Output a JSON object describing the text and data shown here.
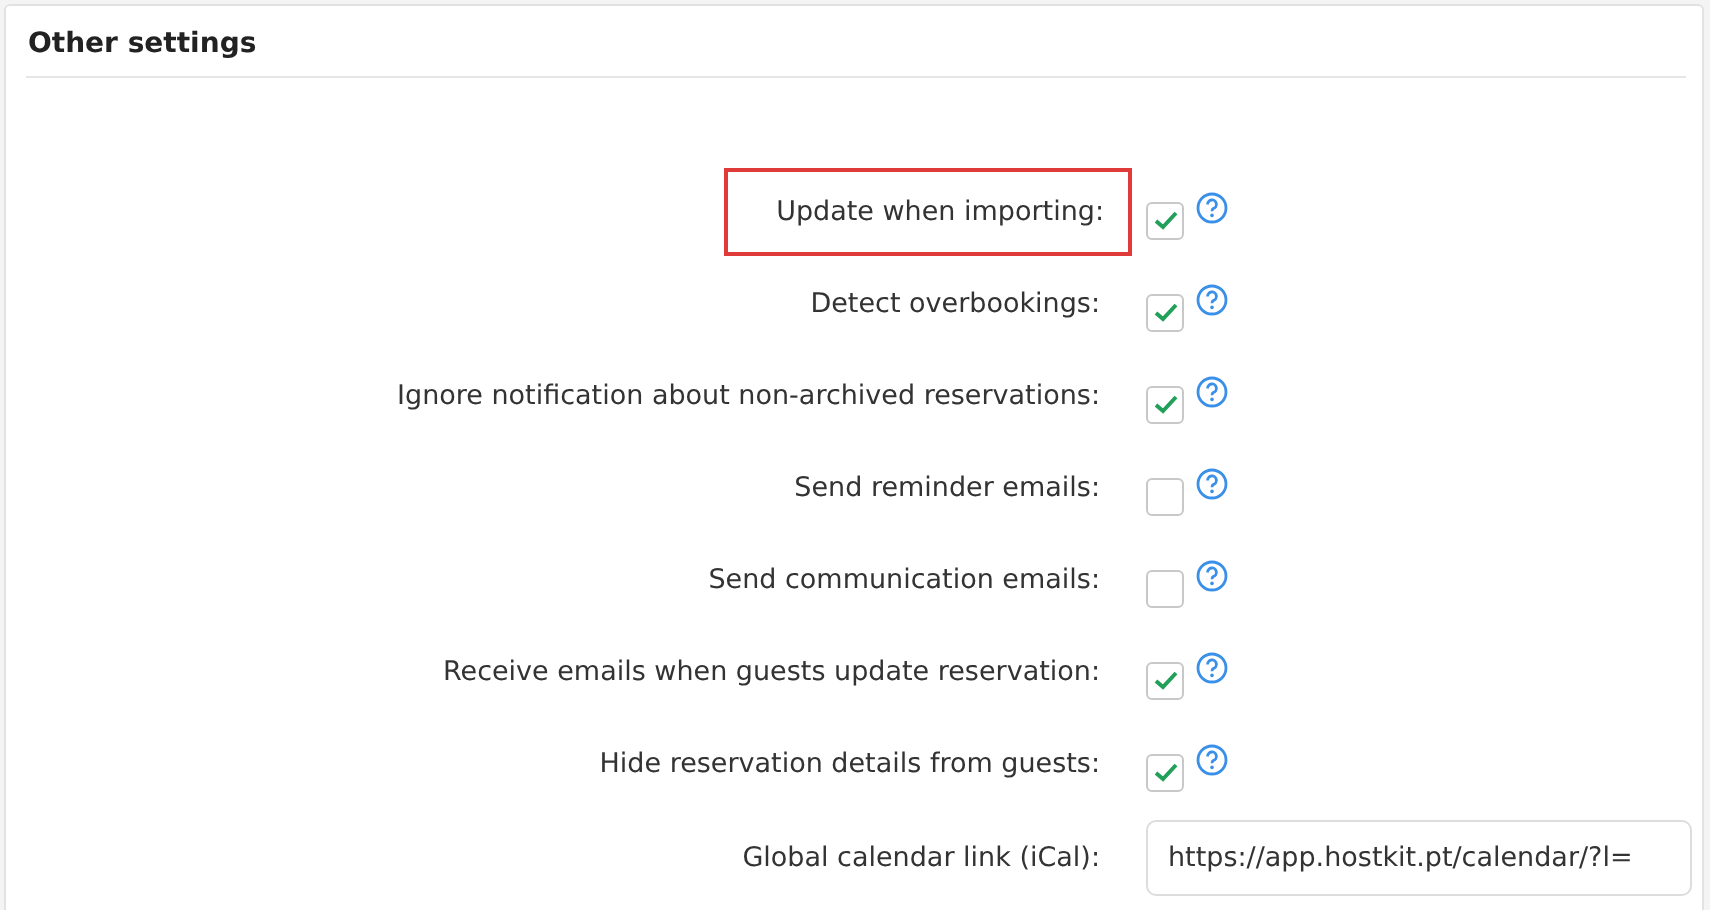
{
  "section": {
    "title": "Other settings"
  },
  "settings": [
    {
      "kind": "checkbox",
      "label": "Update when importing:",
      "checked": true,
      "highlighted": true
    },
    {
      "kind": "checkbox",
      "label": "Detect overbookings:",
      "checked": true,
      "highlighted": false
    },
    {
      "kind": "checkbox",
      "label": "Ignore notification about non-archived reservations:",
      "checked": true,
      "highlighted": false
    },
    {
      "kind": "checkbox",
      "label": "Send reminder emails:",
      "checked": false,
      "highlighted": false
    },
    {
      "kind": "checkbox",
      "label": "Send communication emails:",
      "checked": false,
      "highlighted": false
    },
    {
      "kind": "checkbox",
      "label": "Receive emails when guests update reservation:",
      "checked": true,
      "highlighted": false
    },
    {
      "kind": "checkbox",
      "label": "Hide reservation details from guests:",
      "checked": true,
      "highlighted": false
    },
    {
      "kind": "text",
      "label": "Global calendar link (iCal):",
      "value": "https://app.hostkit.pt/calendar/?l="
    }
  ]
}
